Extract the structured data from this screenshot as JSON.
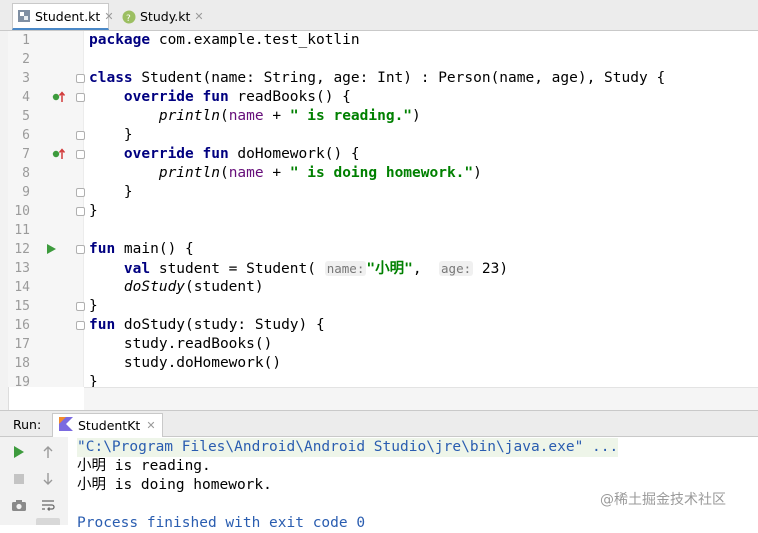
{
  "tabs": [
    {
      "label": "Student.kt",
      "active": true
    },
    {
      "label": "Study.kt",
      "active": false
    }
  ],
  "editor": {
    "line_numbers": [
      "1",
      "2",
      "3",
      "4",
      "5",
      "6",
      "7",
      "8",
      "9",
      "10",
      "11",
      "12",
      "13",
      "14",
      "15",
      "16",
      "17",
      "18",
      "19"
    ],
    "lines": [
      [
        {
          "t": "package",
          "c": "kw"
        },
        {
          "t": " com.example.test_kotlin"
        }
      ],
      [],
      [
        {
          "t": "class",
          "c": "kw"
        },
        {
          "t": " Student(name: String, age: Int) : Person(name, age), Study {"
        }
      ],
      [
        {
          "t": "    override fun",
          "c": "kw"
        },
        {
          "t": " readBooks() {"
        }
      ],
      [
        {
          "t": "        "
        },
        {
          "t": "println",
          "c": "it"
        },
        {
          "t": "("
        },
        {
          "t": "name",
          "c": "param"
        },
        {
          "t": " + "
        },
        {
          "t": "\" is reading.\"",
          "c": "str"
        },
        {
          "t": ")"
        }
      ],
      [
        {
          "t": "    }"
        }
      ],
      [
        {
          "t": "    override fun",
          "c": "kw"
        },
        {
          "t": " doHomework() {"
        }
      ],
      [
        {
          "t": "        "
        },
        {
          "t": "println",
          "c": "it"
        },
        {
          "t": "("
        },
        {
          "t": "name",
          "c": "param"
        },
        {
          "t": " + "
        },
        {
          "t": "\" is doing homework.\"",
          "c": "str"
        },
        {
          "t": ")"
        }
      ],
      [
        {
          "t": "    }"
        }
      ],
      [
        {
          "t": "}"
        }
      ],
      [],
      [
        {
          "t": "fun",
          "c": "kw"
        },
        {
          "t": " main() {"
        }
      ],
      [
        {
          "t": "    val",
          "c": "kw"
        },
        {
          "t": " student = Student( "
        },
        {
          "t": "name:",
          "c": "hint"
        },
        {
          "t": "\"小明\"",
          "c": "str"
        },
        {
          "t": ",  "
        },
        {
          "t": "age:",
          "c": "hint"
        },
        {
          "t": " 23)"
        }
      ],
      [
        {
          "t": "    "
        },
        {
          "t": "doStudy",
          "c": "it"
        },
        {
          "t": "(student)"
        }
      ],
      [
        {
          "t": "}"
        }
      ],
      [
        {
          "t": "fun",
          "c": "kw"
        },
        {
          "t": " doStudy(study: Study) {"
        }
      ],
      [
        {
          "t": "    study.readBooks()"
        }
      ],
      [
        {
          "t": "    study.doHomework()"
        }
      ],
      [
        {
          "t": "}"
        }
      ]
    ]
  },
  "run_panel": {
    "label": "Run:",
    "tab_label": "StudentKt",
    "console_lines": [
      {
        "text": "\"C:\\Program Files\\Android\\Android Studio\\jre\\bin\\java.exe\" ...",
        "color": "#2a5db0"
      },
      {
        "text": "小明 is reading.",
        "color": "#000000"
      },
      {
        "text": "小明 is doing homework.",
        "color": "#000000"
      },
      {
        "text": "",
        "color": "#000000"
      },
      {
        "text": "Process finished with exit code 0",
        "color": "#2a5db0"
      }
    ]
  },
  "watermark": "@稀土掘金技术社区",
  "colors": {
    "keyword": "#000080",
    "string": "#008000",
    "console_cmd": "#2a5db0",
    "run_green": "#3d9b3d"
  },
  "icons": [
    "kotlin-file-icon",
    "close-icon",
    "override-icon",
    "run-icon",
    "fold-icon",
    "rerun-icon",
    "stop-icon",
    "camera-icon",
    "up-arrow-icon",
    "down-arrow-icon",
    "wrap-icon"
  ]
}
